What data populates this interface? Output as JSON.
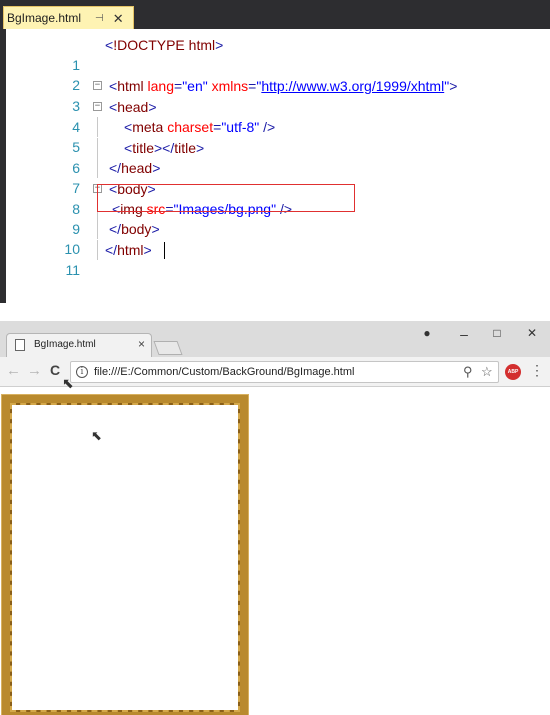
{
  "editor": {
    "tab_title": "BgImage.html",
    "tab_pin": "⊣",
    "tab_close": "✕",
    "lines": [
      {
        "num": "1"
      },
      {
        "num": "2"
      },
      {
        "num": "3"
      },
      {
        "num": "4"
      },
      {
        "num": "5"
      },
      {
        "num": "6"
      },
      {
        "num": "7"
      },
      {
        "num": "8"
      },
      {
        "num": "9"
      },
      {
        "num": "10"
      },
      {
        "num": "11"
      }
    ],
    "code": {
      "l1": {
        "open": "<",
        "tag": "!DOCTYPE",
        "sp": " ",
        "rest": "html",
        "close": ">"
      },
      "l3": {
        "open": "<",
        "tag": "html",
        "a1": " lang",
        "eq1": "=",
        "v1": "\"en\"",
        "a2": " xmlns",
        "eq2": "=",
        "q1": "\"",
        "link": "http://www.w3.org/1999/xhtml",
        "q2": "\"",
        "close": ">"
      },
      "l4": {
        "open": "<",
        "tag": "head",
        "close": ">"
      },
      "l5": {
        "open": "<",
        "tag": "meta",
        "a1": " charset",
        "eq1": "=",
        "v1": "\"utf-8\"",
        "close": " />"
      },
      "l6": {
        "open": "<",
        "tag": "title",
        "close": ">",
        "open2": "</",
        "tag2": "title",
        "close2": ">"
      },
      "l7": {
        "open": "</",
        "tag": "head",
        "close": ">"
      },
      "l8": {
        "open": "<",
        "tag": "body",
        "close": ">"
      },
      "l9": {
        "open": "<",
        "tag": "img",
        "a1": " src",
        "eq1": "=",
        "v1": "\"Images/bg.png\"",
        "close": " />"
      },
      "l10": {
        "open": "</",
        "tag": "body",
        "close": ">"
      },
      "l11": {
        "open": "</",
        "tag": "html",
        "close": ">"
      }
    },
    "fold_markers": [
      "⊟",
      "⊟",
      "⊟"
    ]
  },
  "browser": {
    "tab_title": "BgImage.html",
    "tab_close": "×",
    "window_controls": {
      "account": "●",
      "minimize": "–",
      "maximize": "□",
      "close": "✕"
    },
    "nav": {
      "back": "←",
      "forward": "→",
      "reload": "C"
    },
    "address": {
      "info": "i",
      "url": "file:///E:/Common/Custom/BackGround/BgImage.html",
      "zoom_icon": "⚲",
      "star_icon": "☆"
    },
    "extension_badge": "ABP",
    "menu": "⋮"
  },
  "colors": {
    "editor_tab_active": "#fef3b3",
    "frame_gold": "#b98a2e",
    "highlight_box": "#e03030"
  }
}
